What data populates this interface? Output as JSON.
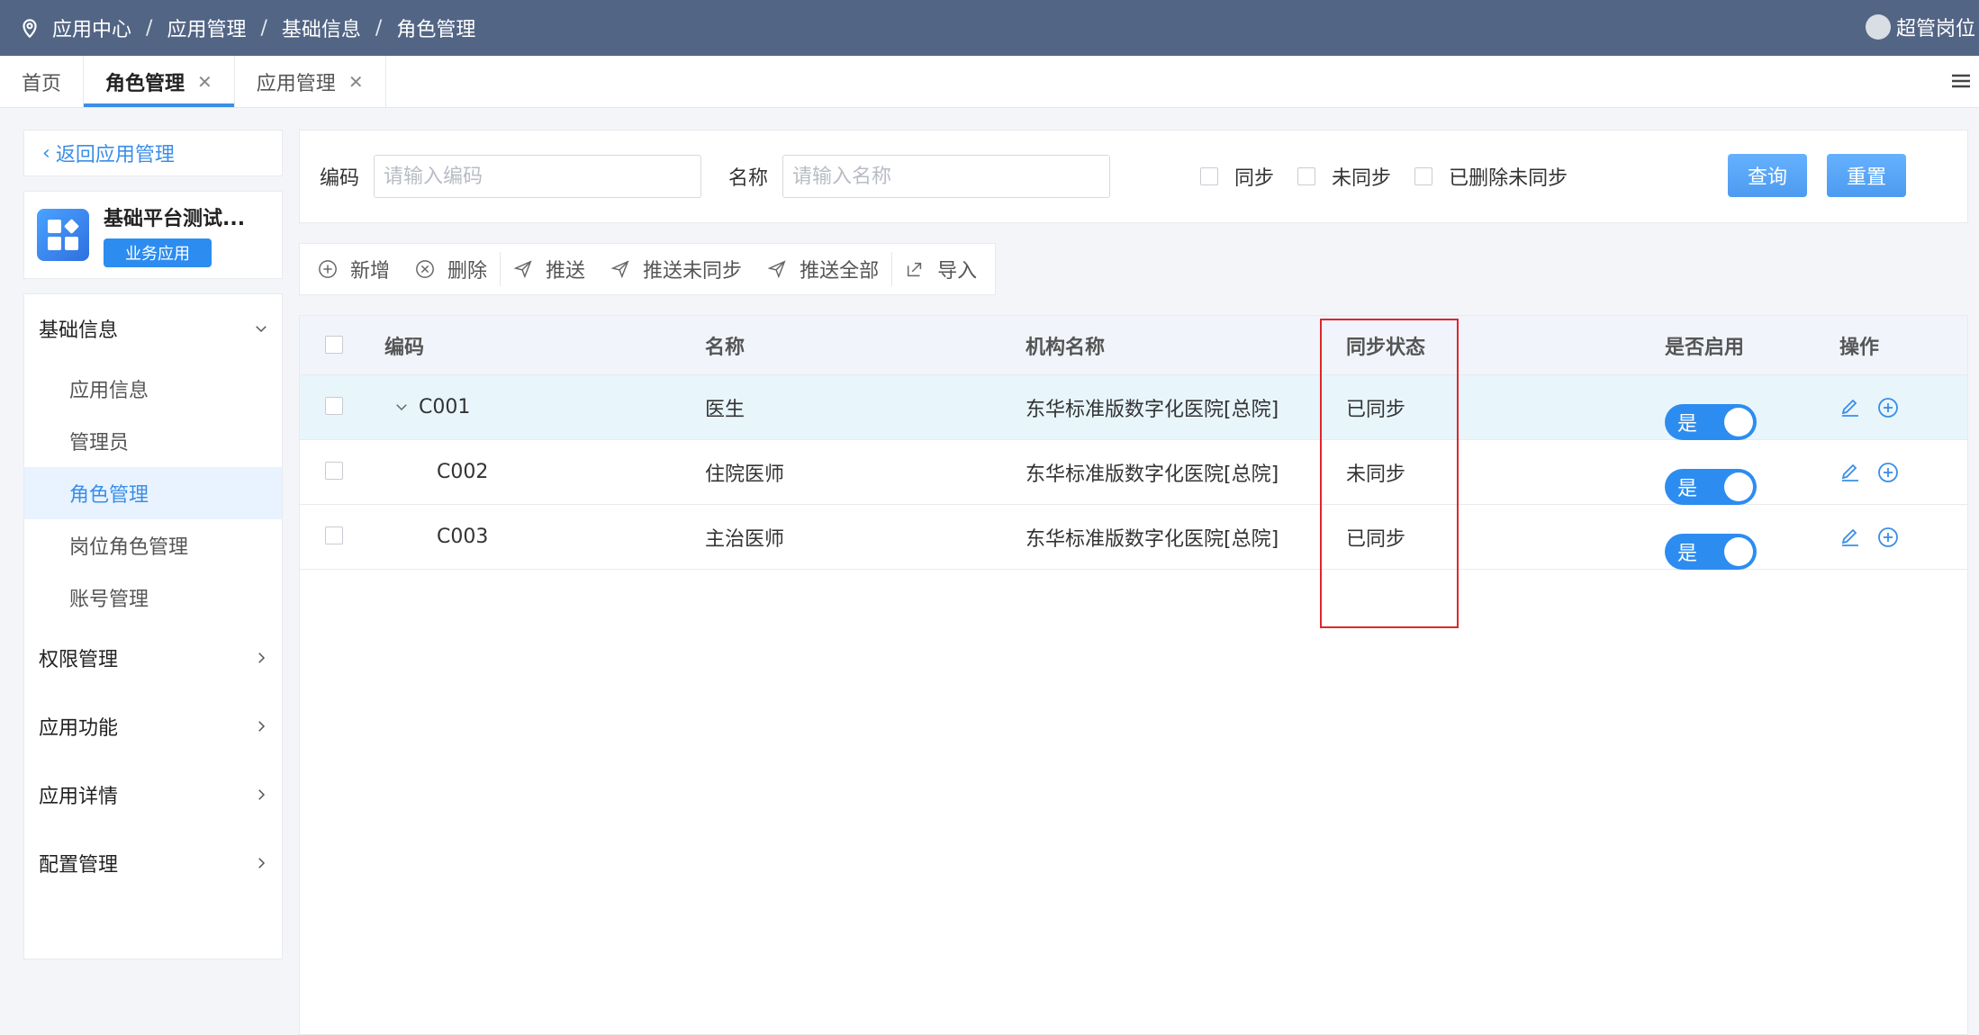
{
  "header": {
    "breadcrumb": [
      "应用中心",
      "应用管理",
      "基础信息",
      "角色管理"
    ],
    "user": "超管岗位"
  },
  "tabs": [
    {
      "label": "首页",
      "active": false,
      "closable": false
    },
    {
      "label": "角色管理",
      "active": true,
      "closable": true
    },
    {
      "label": "应用管理",
      "active": false,
      "closable": true
    }
  ],
  "sidebar": {
    "back_label": "返回应用管理",
    "app": {
      "name": "基础平台测试...",
      "badge": "业务应用"
    },
    "groups": [
      {
        "label": "基础信息",
        "expanded": true,
        "items": [
          "应用信息",
          "管理员",
          "角色管理",
          "岗位角色管理",
          "账号管理"
        ],
        "active_item": "角色管理"
      },
      {
        "label": "权限管理",
        "expanded": false
      },
      {
        "label": "应用功能",
        "expanded": false
      },
      {
        "label": "应用详情",
        "expanded": false
      },
      {
        "label": "配置管理",
        "expanded": false
      }
    ]
  },
  "search": {
    "code_label": "编码",
    "code_placeholder": "请输入编码",
    "name_label": "名称",
    "name_placeholder": "请输入名称",
    "checks": [
      "同步",
      "未同步",
      "已删除未同步"
    ],
    "query_label": "查询",
    "reset_label": "重置"
  },
  "toolbar": {
    "add": "新增",
    "delete": "删除",
    "push": "推送",
    "push_unsynced": "推送未同步",
    "push_all": "推送全部",
    "import": "导入"
  },
  "table": {
    "columns": [
      "编码",
      "名称",
      "机构名称",
      "同步状态",
      "是否启用",
      "操作"
    ],
    "rows": [
      {
        "code": "C001",
        "name": "医生",
        "org": "东华标准版数字化医院[总院]",
        "sync": "已同步",
        "enabled": "是",
        "expanded": true
      },
      {
        "code": "C002",
        "name": "住院医师",
        "org": "东华标准版数字化医院[总院]",
        "sync": "未同步",
        "enabled": "是"
      },
      {
        "code": "C003",
        "name": "主治医师",
        "org": "东华标准版数字化医院[总院]",
        "sync": "已同步",
        "enabled": "是"
      }
    ]
  },
  "colors": {
    "header_bg": "#536585",
    "accent": "#3a8ee6",
    "highlight_box": "#e0262a"
  }
}
